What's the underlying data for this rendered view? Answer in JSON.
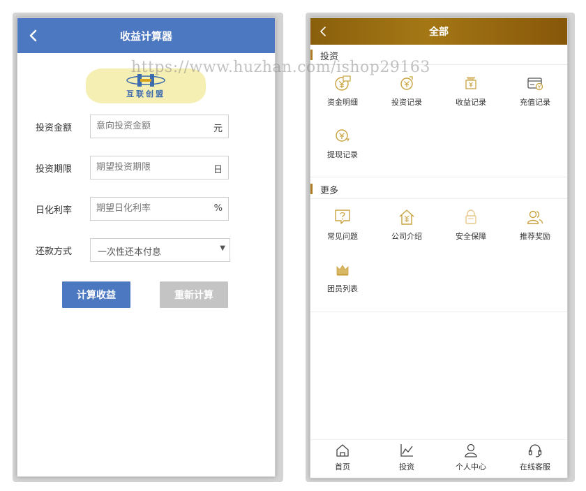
{
  "calculator": {
    "title": "收益计算器",
    "logo_text": "互联创盟",
    "fields": [
      {
        "label": "投资金额",
        "placeholder": "意向投资金额",
        "unit": "元"
      },
      {
        "label": "投资期限",
        "placeholder": "期望投资期限",
        "unit": "日"
      },
      {
        "label": "日化利率",
        "placeholder": "期望日化利率",
        "unit": "%"
      }
    ],
    "repayment": {
      "label": "还款方式",
      "value": "一次性还本付息"
    },
    "calc_button": "计算收益",
    "reset_button": "重新计算",
    "accent": "#4b78c0"
  },
  "menu": {
    "title": "全部",
    "accent": "#a47715",
    "sections": [
      {
        "title": "投资",
        "items": [
          {
            "label": "资金明细",
            "icon": "money-detail-icon"
          },
          {
            "label": "投资记录",
            "icon": "invest-record-icon"
          },
          {
            "label": "收益记录",
            "icon": "income-record-icon"
          },
          {
            "label": "充值记录",
            "icon": "recharge-record-icon"
          },
          {
            "label": "提现记录",
            "icon": "withdraw-record-icon"
          }
        ]
      },
      {
        "title": "更多",
        "items": [
          {
            "label": "常见问题",
            "icon": "faq-icon"
          },
          {
            "label": "公司介绍",
            "icon": "company-icon"
          },
          {
            "label": "安全保障",
            "icon": "security-icon"
          },
          {
            "label": "推荐奖励",
            "icon": "referral-icon"
          },
          {
            "label": "团员列表",
            "icon": "team-icon"
          }
        ]
      }
    ],
    "tabs": [
      {
        "label": "首页",
        "icon": "home-icon"
      },
      {
        "label": "投资",
        "icon": "chart-icon"
      },
      {
        "label": "个人中心",
        "icon": "user-icon"
      },
      {
        "label": "在线客服",
        "icon": "headset-icon"
      }
    ]
  },
  "watermark": "https://www.huzhan.com/ishop29163"
}
